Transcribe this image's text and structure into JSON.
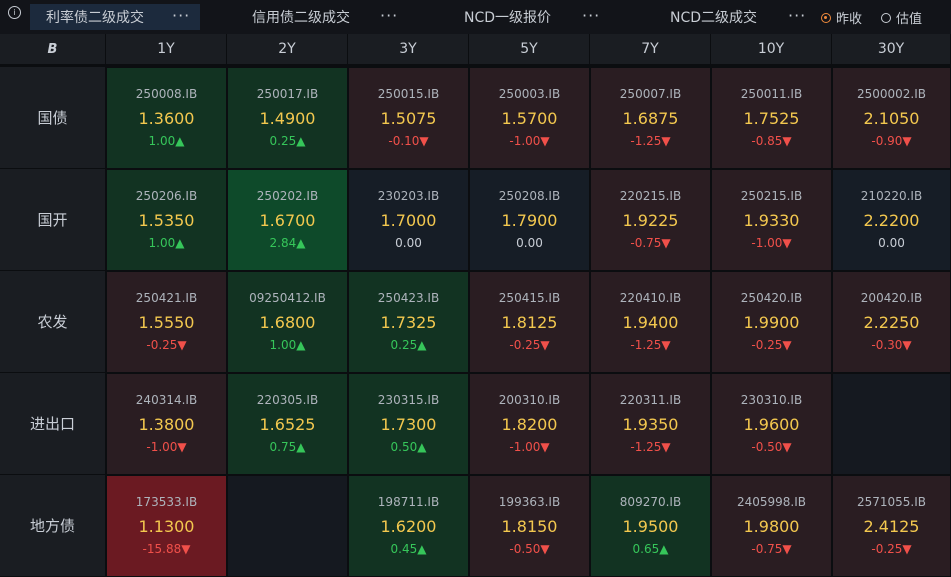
{
  "tabs": [
    {
      "label": "利率债二级成交",
      "active": true
    },
    {
      "label": "信用债二级成交",
      "active": false
    },
    {
      "label": "NCD一级报价",
      "active": false
    },
    {
      "label": "NCD二级成交",
      "active": false
    }
  ],
  "more_glyph": "···",
  "radios": [
    {
      "label": "昨收",
      "checked": true
    },
    {
      "label": "估值",
      "checked": false
    }
  ],
  "corner_icon": "B",
  "columns": [
    "1Y",
    "2Y",
    "3Y",
    "5Y",
    "7Y",
    "10Y",
    "30Y"
  ],
  "rows": [
    {
      "label": "国债",
      "cells": [
        {
          "code": "250008.IB",
          "yield": "1.3600",
          "change": "1.00▲",
          "dir": "up",
          "bg": "g-weak"
        },
        {
          "code": "250017.IB",
          "yield": "1.4900",
          "change": "0.25▲",
          "dir": "up",
          "bg": "g-weak"
        },
        {
          "code": "250015.IB",
          "yield": "1.5075",
          "change": "-0.10▼",
          "dir": "down",
          "bg": "r-weak"
        },
        {
          "code": "250003.IB",
          "yield": "1.5700",
          "change": "-1.00▼",
          "dir": "down",
          "bg": "r-weak"
        },
        {
          "code": "250007.IB",
          "yield": "1.6875",
          "change": "-1.25▼",
          "dir": "down",
          "bg": "r-weak"
        },
        {
          "code": "250011.IB",
          "yield": "1.7525",
          "change": "-0.85▼",
          "dir": "down",
          "bg": "r-weak"
        },
        {
          "code": "2500002.IB",
          "yield": "2.1050",
          "change": "-0.90▼",
          "dir": "down",
          "bg": "r-weak"
        }
      ]
    },
    {
      "label": "国开",
      "cells": [
        {
          "code": "250206.IB",
          "yield": "1.5350",
          "change": "1.00▲",
          "dir": "up",
          "bg": "g-weak"
        },
        {
          "code": "250202.IB",
          "yield": "1.6700",
          "change": "2.84▲",
          "dir": "up",
          "bg": "g-strong"
        },
        {
          "code": "230203.IB",
          "yield": "1.7000",
          "change": "0.00",
          "dir": "flat",
          "bg": "neutral"
        },
        {
          "code": "250208.IB",
          "yield": "1.7900",
          "change": "0.00",
          "dir": "flat",
          "bg": "neutral"
        },
        {
          "code": "220215.IB",
          "yield": "1.9225",
          "change": "-0.75▼",
          "dir": "down",
          "bg": "r-weak"
        },
        {
          "code": "250215.IB",
          "yield": "1.9330",
          "change": "-1.00▼",
          "dir": "down",
          "bg": "r-weak"
        },
        {
          "code": "210220.IB",
          "yield": "2.2200",
          "change": "0.00",
          "dir": "flat",
          "bg": "neutral"
        }
      ]
    },
    {
      "label": "农发",
      "cells": [
        {
          "code": "250421.IB",
          "yield": "1.5550",
          "change": "-0.25▼",
          "dir": "down",
          "bg": "r-weak"
        },
        {
          "code": "09250412.IB",
          "yield": "1.6800",
          "change": "1.00▲",
          "dir": "up",
          "bg": "g-weak"
        },
        {
          "code": "250423.IB",
          "yield": "1.7325",
          "change": "0.25▲",
          "dir": "up",
          "bg": "g-weak"
        },
        {
          "code": "250415.IB",
          "yield": "1.8125",
          "change": "-0.25▼",
          "dir": "down",
          "bg": "r-weak"
        },
        {
          "code": "220410.IB",
          "yield": "1.9400",
          "change": "-1.25▼",
          "dir": "down",
          "bg": "r-weak"
        },
        {
          "code": "250420.IB",
          "yield": "1.9900",
          "change": "-0.25▼",
          "dir": "down",
          "bg": "r-weak"
        },
        {
          "code": "200420.IB",
          "yield": "2.2250",
          "change": "-0.30▼",
          "dir": "down",
          "bg": "r-weak"
        }
      ]
    },
    {
      "label": "进出口",
      "cells": [
        {
          "code": "240314.IB",
          "yield": "1.3800",
          "change": "-1.00▼",
          "dir": "down",
          "bg": "r-weak"
        },
        {
          "code": "220305.IB",
          "yield": "1.6525",
          "change": "0.75▲",
          "dir": "up",
          "bg": "g-weak"
        },
        {
          "code": "230315.IB",
          "yield": "1.7300",
          "change": "0.50▲",
          "dir": "up",
          "bg": "g-weak"
        },
        {
          "code": "200310.IB",
          "yield": "1.8200",
          "change": "-1.00▼",
          "dir": "down",
          "bg": "r-weak"
        },
        {
          "code": "220311.IB",
          "yield": "1.9350",
          "change": "-1.25▼",
          "dir": "down",
          "bg": "r-weak"
        },
        {
          "code": "230310.IB",
          "yield": "1.9600",
          "change": "-0.50▼",
          "dir": "down",
          "bg": "r-weak"
        },
        {
          "code": "",
          "yield": "",
          "change": "",
          "dir": "flat",
          "bg": "empty"
        }
      ]
    },
    {
      "label": "地方债",
      "cells": [
        {
          "code": "173533.IB",
          "yield": "1.1300",
          "change": "-15.88▼",
          "dir": "down",
          "bg": "r-strong"
        },
        {
          "code": "",
          "yield": "",
          "change": "",
          "dir": "flat",
          "bg": "empty"
        },
        {
          "code": "198711.IB",
          "yield": "1.6200",
          "change": "0.45▲",
          "dir": "up",
          "bg": "g-weak"
        },
        {
          "code": "199363.IB",
          "yield": "1.8150",
          "change": "-0.50▼",
          "dir": "down",
          "bg": "r-weak"
        },
        {
          "code": "809270.IB",
          "yield": "1.9500",
          "change": "0.65▲",
          "dir": "up",
          "bg": "g-weak"
        },
        {
          "code": "2405998.IB",
          "yield": "1.9800",
          "change": "-0.75▼",
          "dir": "down",
          "bg": "r-weak"
        },
        {
          "code": "2571055.IB",
          "yield": "2.4125",
          "change": "-0.25▼",
          "dir": "down",
          "bg": "r-weak"
        }
      ]
    }
  ]
}
